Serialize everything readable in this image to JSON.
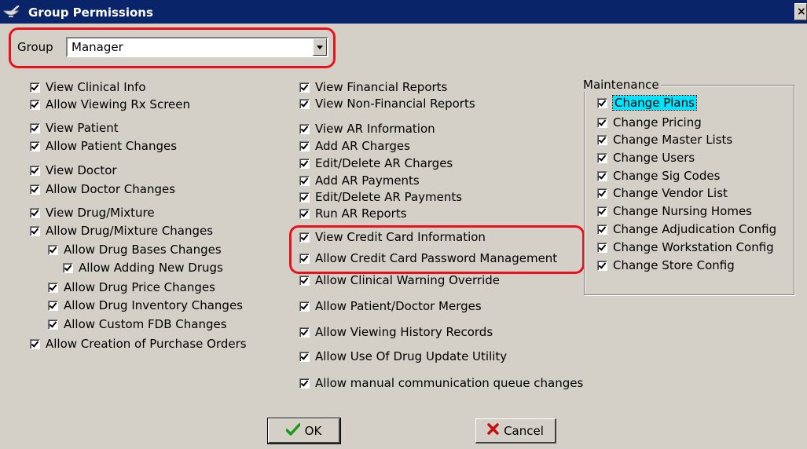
{
  "window": {
    "title": "Group Permissions",
    "close_glyph": "×",
    "icon": "mortar-pestle-icon"
  },
  "group": {
    "label": "Group",
    "selected": "Manager"
  },
  "col1": [
    {
      "label": "View Clinical Info",
      "checked": true
    },
    {
      "label": "Allow Viewing Rx Screen",
      "checked": true
    },
    {
      "label": "View Patient",
      "checked": true
    },
    {
      "label": "Allow Patient Changes",
      "checked": true
    },
    {
      "label": "View Doctor",
      "checked": true
    },
    {
      "label": "Allow Doctor Changes",
      "checked": true
    },
    {
      "label": "View Drug/Mixture",
      "checked": true
    },
    {
      "label": "Allow Drug/Mixture Changes",
      "checked": true
    },
    {
      "label": "Allow Drug Bases Changes",
      "checked": true
    },
    {
      "label": "Allow Adding New Drugs",
      "checked": true
    },
    {
      "label": "Allow Drug Price Changes",
      "checked": true
    },
    {
      "label": "Allow Drug Inventory Changes",
      "checked": true
    },
    {
      "label": "Allow Custom FDB Changes",
      "checked": true
    },
    {
      "label": "Allow Creation of Purchase Orders",
      "checked": true
    }
  ],
  "col2": [
    {
      "label": "View Financial Reports",
      "checked": true
    },
    {
      "label": "View Non-Financial Reports",
      "checked": true
    },
    {
      "label": "View AR Information",
      "checked": true
    },
    {
      "label": "Add AR Charges",
      "checked": true
    },
    {
      "label": "Edit/Delete AR Charges",
      "checked": true
    },
    {
      "label": "Add AR Payments",
      "checked": true
    },
    {
      "label": "Edit/Delete AR Payments",
      "checked": true
    },
    {
      "label": "Run AR Reports",
      "checked": true
    },
    {
      "label": "View Credit Card Information",
      "checked": true
    },
    {
      "label": "Allow Credit Card Password Management",
      "checked": true
    },
    {
      "label": "Allow Clinical Warning Override",
      "checked": true
    },
    {
      "label": "Allow Patient/Doctor  Merges",
      "checked": true
    },
    {
      "label": "Allow Viewing History Records",
      "checked": true
    },
    {
      "label": "Allow Use Of Drug Update Utility",
      "checked": true
    },
    {
      "label": "Allow manual communication queue changes",
      "checked": true
    }
  ],
  "maintenance": {
    "title": "Maintenance",
    "items": [
      {
        "label": "Change Plans",
        "checked": true,
        "focused": true
      },
      {
        "label": "Change Pricing",
        "checked": true
      },
      {
        "label": "Change Master Lists",
        "checked": true
      },
      {
        "label": "Change Users",
        "checked": true
      },
      {
        "label": "Change Sig Codes",
        "checked": true
      },
      {
        "label": "Change Vendor List",
        "checked": true
      },
      {
        "label": "Change Nursing Homes",
        "checked": true
      },
      {
        "label": "Change Adjudication Config",
        "checked": true
      },
      {
        "label": "Change Workstation Config",
        "checked": true
      },
      {
        "label": "Change Store Config",
        "checked": true
      }
    ]
  },
  "buttons": {
    "ok": {
      "label": "OK",
      "icon": "checkmark-icon",
      "color": "#1a9a1a"
    },
    "cancel": {
      "label": "Cancel",
      "icon": "x-icon",
      "color": "#c81010"
    }
  },
  "highlight_color": "#e8121a",
  "focus_color": "#00e5ff"
}
